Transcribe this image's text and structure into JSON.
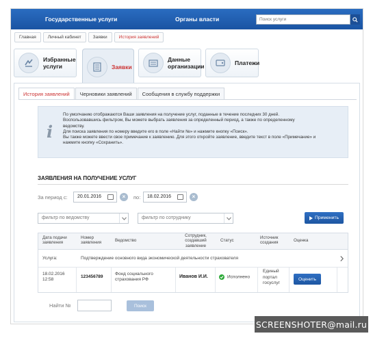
{
  "header": {
    "nav": [
      "Государственные услуги",
      "Органы власти"
    ],
    "search_placeholder": "Поиск услуги"
  },
  "breadcrumbs": [
    "Главная",
    "Личный кабинет",
    "Заявки",
    "История заявлений"
  ],
  "main_tabs": [
    {
      "label_1": "Избранные",
      "label_2": "услуги",
      "icon": "star-icon"
    },
    {
      "label_1": "Заявки",
      "label_2": "",
      "icon": "list-icon"
    },
    {
      "label_1": "Данные",
      "label_2": "организации",
      "icon": "building-icon"
    },
    {
      "label_1": "Платежи",
      "label_2": "",
      "icon": "wallet-icon"
    }
  ],
  "sub_tabs": [
    "История заявлений",
    "Черновики заявлений",
    "Сообщения в службу поддержки"
  ],
  "info_lines": [
    "По умолчанию отображаются Ваши заявления на получение услуг, поданные в течение последних 30 дней.",
    "Воспользовавшись фильтром, Вы можете выбрать заявления за определенный период, а также по определенному",
    "ведомству.",
    "Для поиска заявления по номеру введите его в поле «Найти №» и нажмите кнопку «Поиск».",
    "Вы также можете ввести свое примечание к заявлению. Для этого откройте заявление, введите текст в поле «Примечание» и",
    "нажмите кнопку «Сохранить»."
  ],
  "section_title": "ЗАЯВЛЕНИЯ НА ПОЛУЧЕНИЕ УСЛУГ",
  "filters": {
    "period_from_label": "За период с:",
    "date_from": "20.01.2016",
    "period_to_label": "по:",
    "date_to": "18.02.2016",
    "agency_placeholder": "фильтр по ведомству",
    "employee_placeholder": "фильтр по сотруднику",
    "apply_label": "Применить"
  },
  "table": {
    "headers": [
      "Дата подачи заявления",
      "Номер заявления",
      "Ведомство",
      "Сотрудник, создавший заявление",
      "Статус",
      "Источник создания",
      "Оценка"
    ],
    "service_label": "Услуга:",
    "service_name": "Подтверждение основного вида экономической деятельности страхователя",
    "row": {
      "date": "18.02.2016",
      "time": "12:58",
      "number": "123456789",
      "agency_1": "Фонд социального",
      "agency_2": "страхования РФ",
      "employee": "Иванов И.И.",
      "status": "Исполнено",
      "source_1": "Единый",
      "source_2": "портал",
      "source_3": "госуслуг",
      "rate_label": "Оценить"
    }
  },
  "find": {
    "label": "Найти №",
    "button": "Поиск"
  },
  "colors": {
    "brand": "#1d56a2",
    "accent_red": "#cc3333",
    "success": "#2eaa3a"
  },
  "watermark": "SCREENSHOTER@mail.ru"
}
